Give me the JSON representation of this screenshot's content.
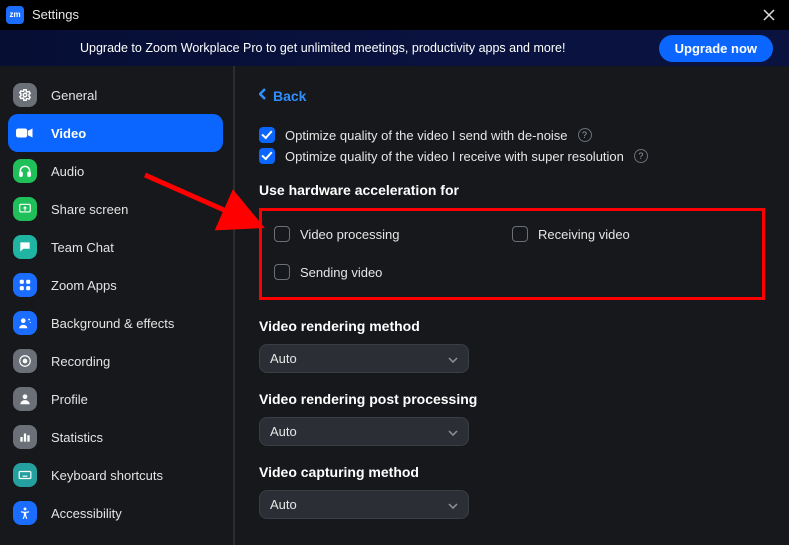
{
  "title": "Settings",
  "app_glyph": "zm",
  "banner": {
    "text": "Upgrade to Zoom Workplace Pro to get unlimited meetings, productivity apps and more!",
    "button": "Upgrade now"
  },
  "sidebar": {
    "items": [
      {
        "label": "General",
        "icon": "gear",
        "color": "#6a6f78"
      },
      {
        "label": "Video",
        "icon": "camera",
        "color": "#ffffff"
      },
      {
        "label": "Audio",
        "icon": "headphones",
        "color": "#1fbf5a"
      },
      {
        "label": "Share screen",
        "icon": "share",
        "color": "#1fbf5a"
      },
      {
        "label": "Team Chat",
        "icon": "chat",
        "color": "#1fb5a2"
      },
      {
        "label": "Zoom Apps",
        "icon": "apps",
        "color": "#1a6dff"
      },
      {
        "label": "Background & effects",
        "icon": "effects",
        "color": "#1a6dff"
      },
      {
        "label": "Recording",
        "icon": "record",
        "color": "#6a6f78"
      },
      {
        "label": "Profile",
        "icon": "profile",
        "color": "#6a6f78"
      },
      {
        "label": "Statistics",
        "icon": "stats",
        "color": "#6a6f78"
      },
      {
        "label": "Keyboard shortcuts",
        "icon": "keyboard",
        "color": "#24a0a0"
      },
      {
        "label": "Accessibility",
        "icon": "accessibility",
        "color": "#1a6dff"
      }
    ],
    "active_index": 1
  },
  "content": {
    "back": "Back",
    "optimize_send": "Optimize quality of the video I send with de-noise",
    "optimize_receive": "Optimize quality of the video I receive with super resolution",
    "hw_header": "Use hardware acceleration for",
    "hw": {
      "video_processing": "Video processing",
      "receiving": "Receiving video",
      "sending": "Sending video"
    },
    "rendering_header": "Video rendering method",
    "rendering_value": "Auto",
    "post_header": "Video rendering post processing",
    "post_value": "Auto",
    "capture_header": "Video capturing method",
    "capture_value": "Auto"
  }
}
